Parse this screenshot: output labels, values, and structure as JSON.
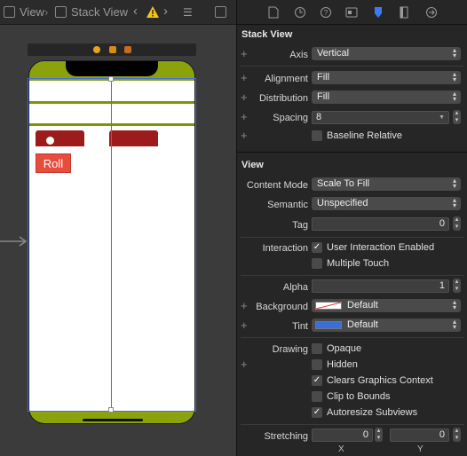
{
  "jumpbar": {
    "view_label": "View",
    "stack_view_label": "Stack View"
  },
  "canvas": {
    "roll_button": "Roll"
  },
  "inspector": {
    "stack_view": {
      "title": "Stack View",
      "axis": {
        "label": "Axis",
        "value": "Vertical"
      },
      "alignment": {
        "label": "Alignment",
        "value": "Fill"
      },
      "distribution": {
        "label": "Distribution",
        "value": "Fill"
      },
      "spacing": {
        "label": "Spacing",
        "value": "8"
      },
      "baseline_relative": {
        "label": "Baseline Relative",
        "checked": false
      }
    },
    "view": {
      "title": "View",
      "content_mode": {
        "label": "Content Mode",
        "value": "Scale To Fill"
      },
      "semantic": {
        "label": "Semantic",
        "value": "Unspecified"
      },
      "tag": {
        "label": "Tag",
        "value": "0"
      },
      "interaction": {
        "label": "Interaction",
        "user_interaction": {
          "label": "User Interaction Enabled",
          "checked": true
        },
        "multiple_touch": {
          "label": "Multiple Touch",
          "checked": false
        }
      },
      "alpha": {
        "label": "Alpha",
        "value": "1"
      },
      "background": {
        "label": "Background",
        "value": "Default"
      },
      "tint": {
        "label": "Tint",
        "value": "Default",
        "color": "#3a6fd8"
      },
      "drawing": {
        "label": "Drawing",
        "opaque": {
          "label": "Opaque",
          "checked": false
        },
        "hidden": {
          "label": "Hidden",
          "checked": false
        },
        "clears_graphics": {
          "label": "Clears Graphics Context",
          "checked": true
        },
        "clip_to_bounds": {
          "label": "Clip to Bounds",
          "checked": false
        },
        "autoresize": {
          "label": "Autoresize Subviews",
          "checked": true
        }
      },
      "stretching": {
        "label": "Stretching",
        "x_value": "0",
        "y_value": "0",
        "x_label": "X",
        "y_label": "Y"
      }
    }
  },
  "colors": {
    "device_green": "#8ba20c",
    "tile_red": "#9c1b1b",
    "roll_red": "#e74c3c",
    "selection_blue": "#4a6fd8"
  }
}
